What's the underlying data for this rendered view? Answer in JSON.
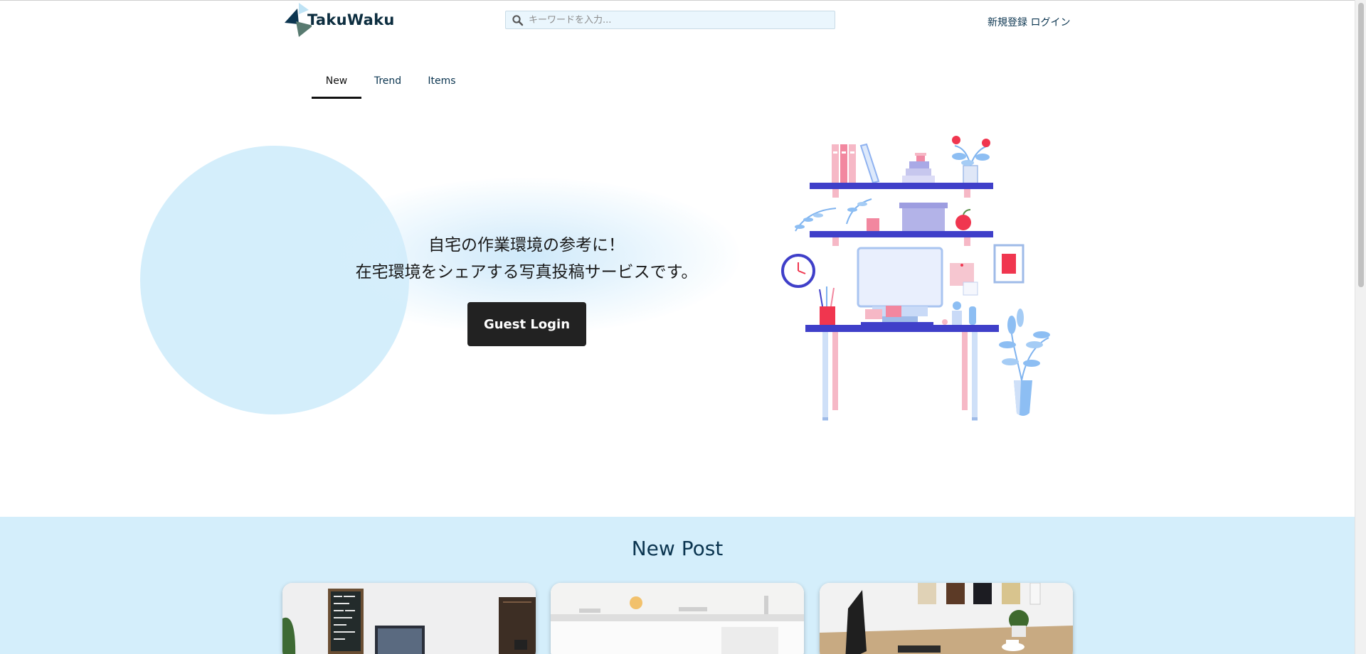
{
  "header": {
    "logo_text": "TakuWaku",
    "search": {
      "placeholder": "キーワードを入力...",
      "value": ""
    },
    "signup_label": "新規登録",
    "login_label": "ログイン"
  },
  "tabs": [
    {
      "label": "New",
      "active": true
    },
    {
      "label": "Trend",
      "active": false
    },
    {
      "label": "Items",
      "active": false
    }
  ],
  "hero": {
    "line1": "自宅の作業環境の参考に！",
    "line2": "在宅環境をシェアする写真投稿サービスです。",
    "guest_login_label": "Guest Login"
  },
  "new_post": {
    "title": "New Post",
    "cards": [
      {
        "image": "home-office-desk-with-monitor-photo"
      },
      {
        "image": "white-kitchen-counter-photo"
      },
      {
        "image": "wooden-desk-with-monitor-and-plant-photo"
      }
    ]
  },
  "colors": {
    "accent_light_blue": "#d4eefb",
    "navy_text": "#0b3550",
    "button_dark": "#222222"
  }
}
